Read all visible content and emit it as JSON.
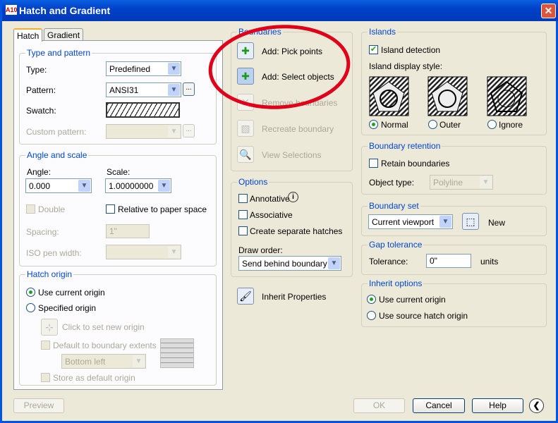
{
  "window": {
    "title": "Hatch and Gradient",
    "app_icon": "A10"
  },
  "tabs": [
    "Hatch",
    "Gradient"
  ],
  "type_pattern": {
    "legend": "Type and pattern",
    "type_label": "Type:",
    "type_value": "Predefined",
    "pattern_label": "Pattern:",
    "pattern_value": "ANSI31",
    "swatch_label": "Swatch:",
    "custom_label": "Custom pattern:",
    "ellipsis": "..."
  },
  "angle_scale": {
    "legend": "Angle and scale",
    "angle_label": "Angle:",
    "angle_value": "0.000",
    "scale_label": "Scale:",
    "scale_value": "1.00000000",
    "double_label": "Double",
    "relative_label": "Relative to paper space",
    "spacing_label": "Spacing:",
    "spacing_value": "1\"",
    "iso_label": "ISO pen width:"
  },
  "hatch_origin": {
    "legend": "Hatch origin",
    "use_current": "Use current origin",
    "specified": "Specified origin",
    "click_set": "Click to set new origin",
    "default_extents": "Default to boundary extents",
    "position_value": "Bottom left",
    "store_default": "Store as default origin"
  },
  "boundaries": {
    "legend": "Boundaries",
    "pick_points": "Add: Pick points",
    "select_objects": "Add: Select objects",
    "remove": "Remove boundaries",
    "recreate": "Recreate boundary",
    "view": "View Selections"
  },
  "options": {
    "legend": "Options",
    "annotative": "Annotative",
    "associative": "Associative",
    "separate": "Create separate hatches",
    "draw_order_label": "Draw order:",
    "draw_order_value": "Send behind boundary"
  },
  "inherit_properties": "Inherit Properties",
  "islands": {
    "legend": "Islands",
    "detection": "Island detection",
    "style_label": "Island display style:",
    "styles": [
      "Normal",
      "Outer",
      "Ignore"
    ],
    "selected": "Normal"
  },
  "boundary_retention": {
    "legend": "Boundary retention",
    "retain": "Retain boundaries",
    "object_type_label": "Object type:",
    "object_type_value": "Polyline"
  },
  "boundary_set": {
    "legend": "Boundary set",
    "value": "Current viewport",
    "new_label": "New"
  },
  "gap": {
    "legend": "Gap tolerance",
    "label": "Tolerance:",
    "value": "0\"",
    "units": "units"
  },
  "inherit_options": {
    "legend": "Inherit options",
    "use_current": "Use current origin",
    "use_source": "Use source hatch origin"
  },
  "footer": {
    "preview": "Preview",
    "ok": "OK",
    "cancel": "Cancel",
    "help": "Help"
  },
  "colors": {
    "annotation": "#e0001a",
    "title_bar": "#0041c8"
  }
}
